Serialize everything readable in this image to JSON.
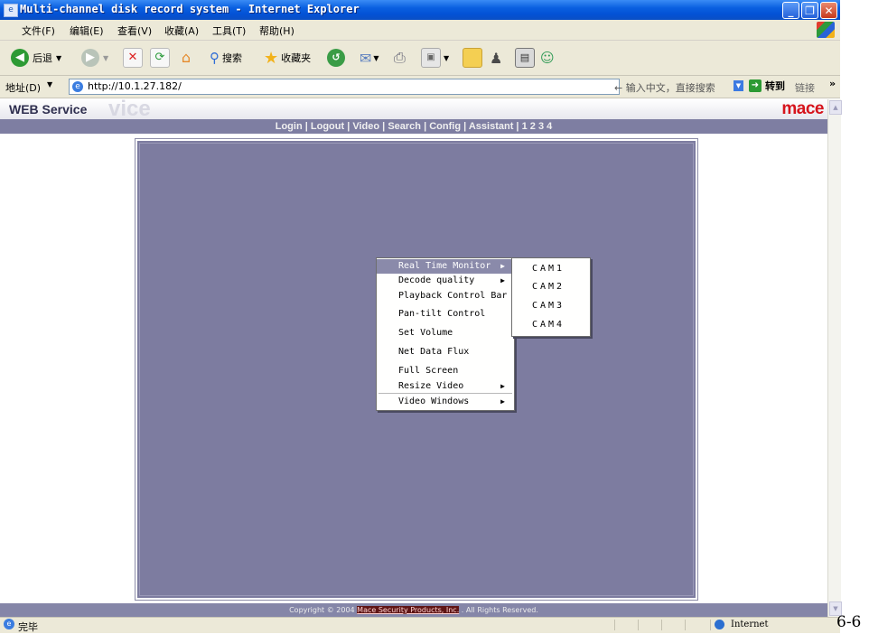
{
  "window": {
    "title": "Multi-channel disk record system - Internet Explorer"
  },
  "menubar": [
    "文件(F)",
    "编辑(E)",
    "查看(V)",
    "收藏(A)",
    "工具(T)",
    "帮助(H)"
  ],
  "toolbar": {
    "back_label": "后退",
    "search_label": "搜索",
    "favorites_label": "收藏夹"
  },
  "addressbar": {
    "label": "地址(D)",
    "url": "http://10.1.27.182/",
    "search_hint": "← 输入中文，直接搜索",
    "go_label": "转到",
    "links_label": "链接"
  },
  "web": {
    "title": "WEB Service",
    "ghost_text": "vice",
    "logo": "mace",
    "nav": [
      "Login",
      "Logout",
      "Video",
      "Search",
      "Config",
      "Assistant",
      "1",
      "2",
      "3",
      "4"
    ]
  },
  "context_menu": {
    "items": [
      {
        "label": "Real Time Monitor",
        "submenu": true,
        "highlighted": true
      },
      {
        "label": "Decode quality",
        "submenu": true
      },
      {
        "label": "Playback Control Bar"
      },
      {
        "label": "Pan-tilt Control"
      },
      {
        "label": "Set Volume"
      },
      {
        "label": "Net Data Flux"
      },
      {
        "label": "Full Screen"
      },
      {
        "label": "Resize Video",
        "submenu": true
      },
      {
        "label": "Video Windows",
        "submenu": true
      }
    ]
  },
  "submenu": {
    "items": [
      "CAM1",
      "CAM2",
      "CAM3",
      "CAM4"
    ]
  },
  "footer": {
    "prefix": "Copyright © 2004 ",
    "brand": "Mace Security Products, Inc.",
    "suffix": " . All Rights Reserved."
  },
  "statusbar": {
    "status": "完毕",
    "zone": "Internet"
  },
  "corner_text": "6-6"
}
